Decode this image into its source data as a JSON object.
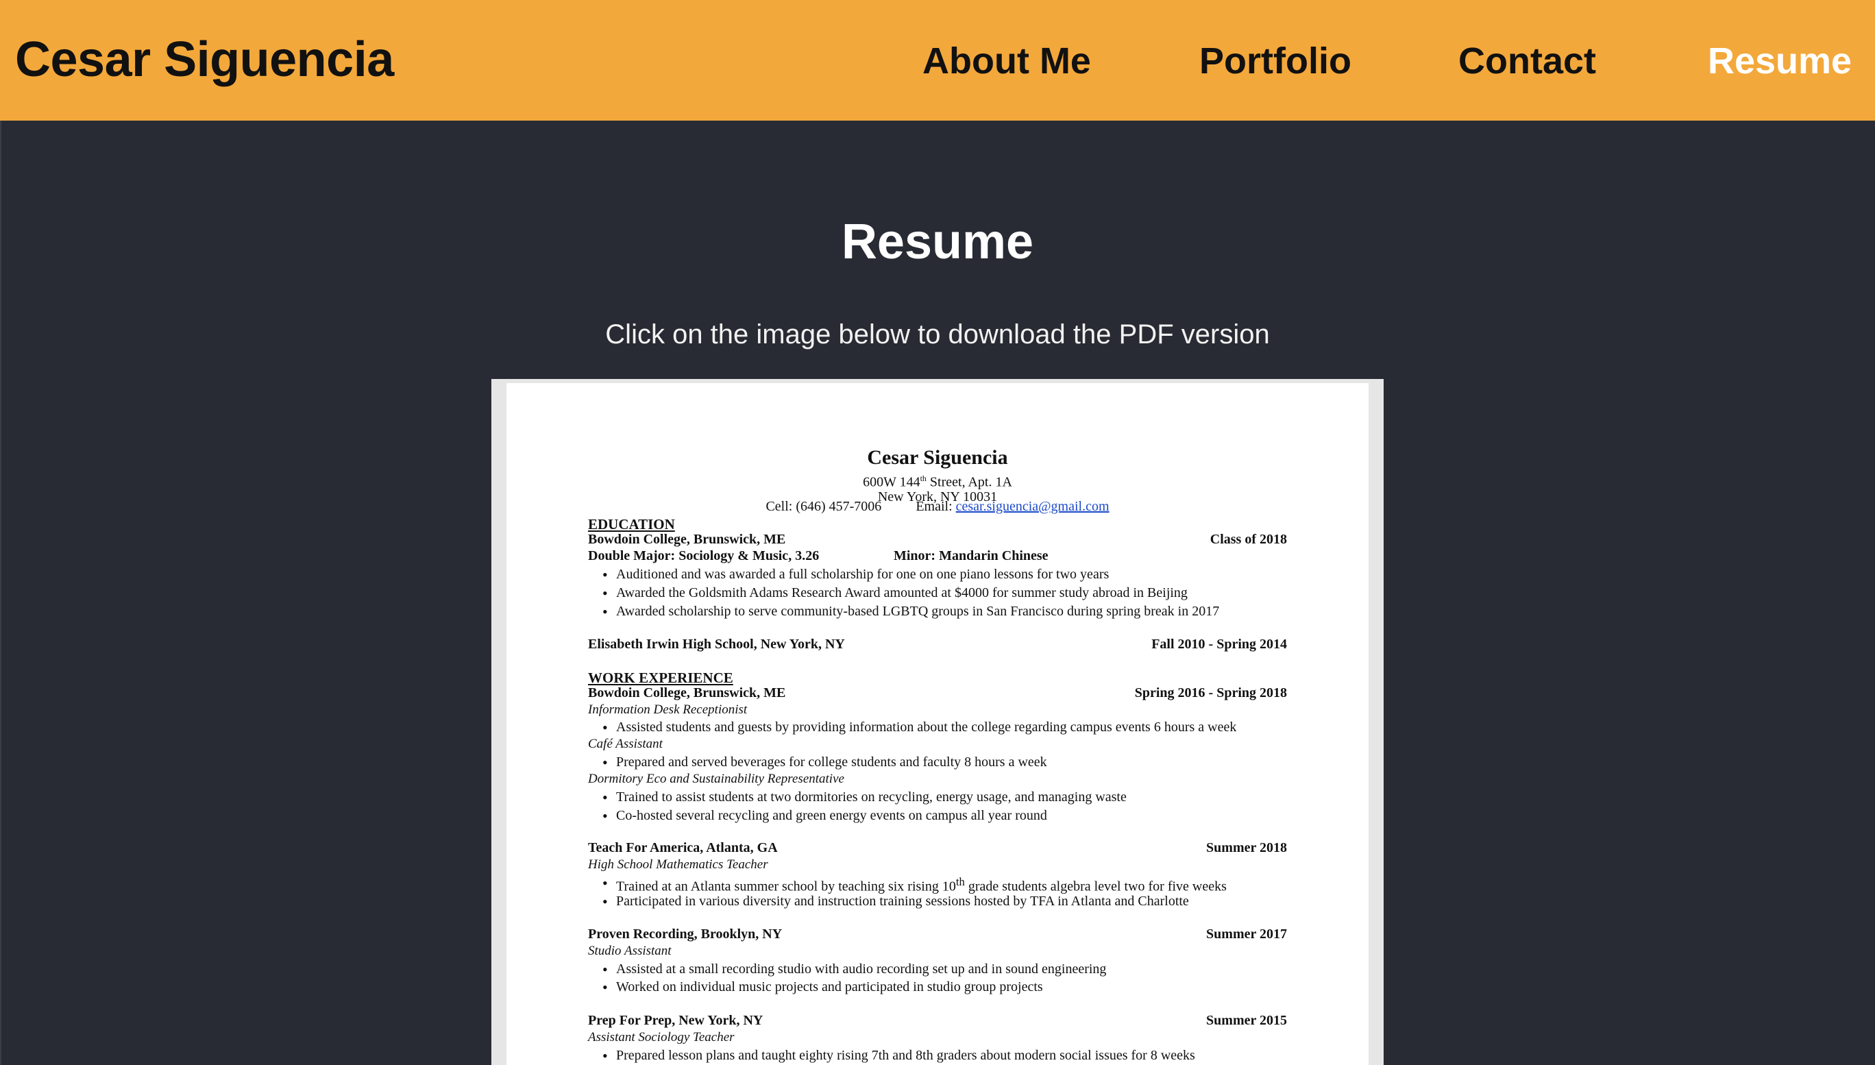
{
  "site": {
    "brand": "Cesar Siguencia",
    "nav": [
      {
        "label": "About Me"
      },
      {
        "label": "Portfolio"
      },
      {
        "label": "Contact"
      },
      {
        "label": "Resume",
        "active": true
      }
    ]
  },
  "main": {
    "title": "Resume",
    "subtitle": "Click on the image below to download the PDF version"
  },
  "resume": {
    "name": "Cesar Siguencia",
    "address_line1_pre": "600W 144",
    "address_line1_sup": "th",
    "address_line1_post": " Street, Apt. 1A",
    "address_line2": "New York, NY 10031",
    "cell": "Cell: (646) 457-7006",
    "email_label": "Email:",
    "email": "cesar.siguencia@gmail.com",
    "education_heading": "EDUCATION",
    "edu1_school": "Bowdoin College, Brunswick, ME",
    "edu1_date": "Class of 2018",
    "edu1_major": "Double Major: Sociology & Music, 3.26",
    "edu1_minor": "Minor: Mandarin Chinese",
    "edu1_bullets": [
      "Auditioned and was awarded a full scholarship for one on one piano lessons for two years",
      "Awarded the Goldsmith Adams Research Award amounted at $4000 for summer study abroad in Beijing",
      "Awarded scholarship to serve community-based LGBTQ groups in San Francisco during spring break in 2017"
    ],
    "edu2_school": "Elisabeth Irwin High School, New York, NY",
    "edu2_date": "Fall 2010 - Spring 2014",
    "work_heading": "WORK EXPERIENCE",
    "job1_org": "Bowdoin College, Brunswick, ME",
    "job1_date": "Spring 2016 - Spring 2018",
    "job1_role1": "Information Desk Receptionist",
    "job1_role1_bullet": "Assisted students and guests by providing information about the college regarding campus events 6 hours a week",
    "job1_role2": "Café Assistant",
    "job1_role2_bullet": "Prepared and served beverages for college students and faculty 8 hours a week",
    "job1_role3": "Dormitory Eco and Sustainability Representative",
    "job1_role3_bullets": [
      "Trained to assist students at two dormitories on recycling, energy usage, and managing waste",
      "Co-hosted several recycling and green energy events on campus all year round"
    ],
    "job2_org": "Teach For America, Atlanta, GA",
    "job2_date": "Summer 2018",
    "job2_role": "High School Mathematics Teacher",
    "job2_bullet1_pre": "Trained at an Atlanta summer school by teaching six rising 10",
    "job2_bullet1_sup": "th",
    "job2_bullet1_post": " grade students algebra level two for five weeks",
    "job2_bullet2": "Participated in various diversity and instruction training sessions hosted by TFA in Atlanta and Charlotte",
    "job3_org": "Proven Recording, Brooklyn, NY",
    "job3_date": "Summer 2017",
    "job3_role": "Studio Assistant",
    "job3_bullets": [
      "Assisted at a small recording studio with audio recording set up and in sound engineering",
      "Worked on individual music projects and participated in studio group projects"
    ],
    "job4_org": "Prep For Prep, New York, NY",
    "job4_date": "Summer 2015",
    "job4_role": "Assistant Sociology Teacher",
    "job4_bullet": "Prepared lesson plans and taught eighty rising 7th and 8th graders about modern social issues for 8 weeks"
  },
  "colors": {
    "header": "#f3a83b",
    "background": "#282b33",
    "nav_active": "#ffffff",
    "link": "#1a49c9"
  }
}
